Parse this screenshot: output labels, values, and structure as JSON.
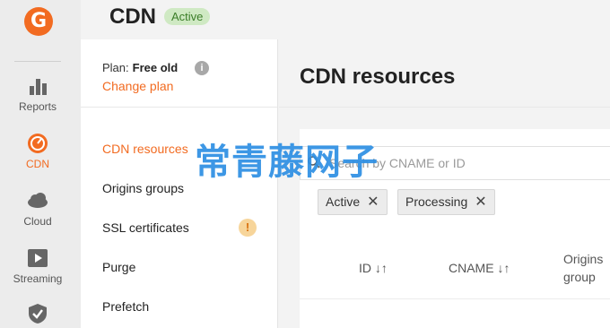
{
  "rail": {
    "items": [
      {
        "label": "Reports",
        "icon": "bar-chart-icon",
        "active": false
      },
      {
        "label": "CDN",
        "icon": "speedometer-icon",
        "active": true
      },
      {
        "label": "Cloud",
        "icon": "cloud-icon",
        "active": false
      },
      {
        "label": "Streaming",
        "icon": "play-icon",
        "active": false
      },
      {
        "label": "",
        "icon": "shield-check-icon",
        "active": false
      }
    ]
  },
  "header": {
    "title": "CDN",
    "status": "Active"
  },
  "plan": {
    "label": "Plan:",
    "value": "Free old",
    "change_link": "Change plan"
  },
  "subnav": {
    "items": [
      {
        "label": "CDN resources",
        "active": true
      },
      {
        "label": "Origins groups",
        "active": false
      },
      {
        "label": "SSL certificates",
        "active": false,
        "warning": true
      },
      {
        "label": "Purge",
        "active": false
      },
      {
        "label": "Prefetch",
        "active": false
      }
    ]
  },
  "main": {
    "title": "CDN resources",
    "search": {
      "placeholder": "Search by CNAME or ID"
    },
    "filters": [
      {
        "label": "Active"
      },
      {
        "label": "Processing"
      }
    ],
    "columns": [
      {
        "label": "ID ↓↑"
      },
      {
        "label": "CNAME ↓↑"
      },
      {
        "label": "Origins",
        "label2": "group"
      }
    ]
  },
  "watermark": "常青藤网子",
  "colors": {
    "accent": "#f26b21",
    "badge_bg": "#cfe9c3",
    "badge_text": "#3b7d28",
    "watermark": "#2d8fe3"
  }
}
